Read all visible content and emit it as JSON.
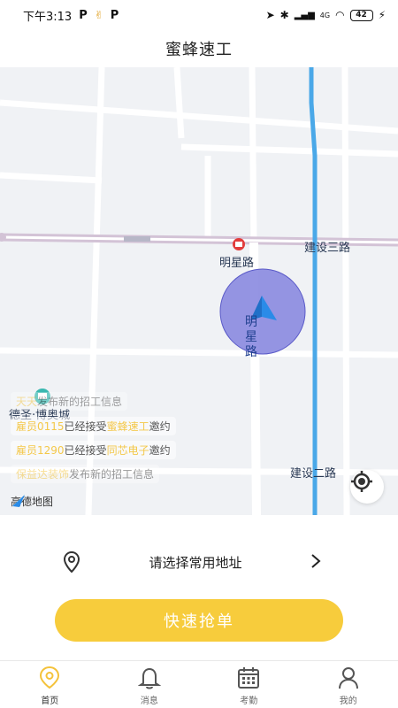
{
  "status_bar": {
    "time": "下午3:13",
    "left_icons": [
      "P",
      "P"
    ],
    "network": "4G",
    "battery": "42"
  },
  "header": {
    "title": "蜜蜂速工"
  },
  "map": {
    "roads": {
      "jianshe_3": "建设三路",
      "jianshe_2": "建设二路",
      "mingxing": "明星路",
      "mingxing_vertical": "明星路"
    },
    "poi": "德圣·博奥城",
    "attribution": "高德地图",
    "colors": {
      "location_circle": "#8a8ae0",
      "river": "#4aa8e8",
      "road": "#ffffff",
      "major_road": "#c9b6c9"
    }
  },
  "ticker": [
    {
      "highlight": "天天",
      "text": "发布新的招工信息",
      "after": ""
    },
    {
      "highlight": "雇员0115",
      "text": "已经接受",
      "company": "蜜蜂速工",
      "after": "邀约"
    },
    {
      "highlight": "雇员1290",
      "text": "已经接受",
      "company": "同芯电子",
      "after": "邀约"
    },
    {
      "highlight": "保益达装饰",
      "text": "发布新的招工信息",
      "after": ""
    }
  ],
  "address": {
    "label": "请选择常用地址"
  },
  "actions": {
    "grab_label": "快速抢单",
    "color": "#f7cc3c"
  },
  "tabs": [
    {
      "label": "首页",
      "icon": "location-pin-icon",
      "active": true
    },
    {
      "label": "消息",
      "icon": "bell-icon",
      "active": false
    },
    {
      "label": "考勤",
      "icon": "calendar-icon",
      "active": false
    },
    {
      "label": "我的",
      "icon": "user-icon",
      "active": false
    }
  ]
}
